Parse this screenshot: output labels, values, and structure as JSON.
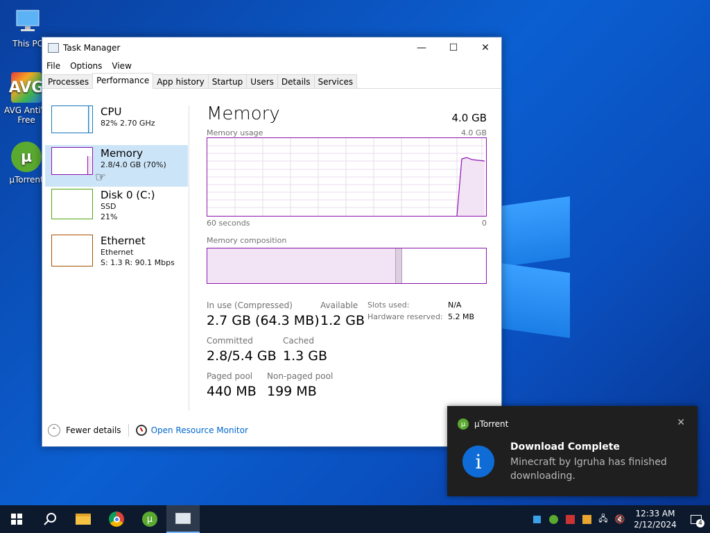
{
  "desktop": {
    "icons": [
      {
        "label": "This PC"
      },
      {
        "label": "AVG AntiVi Free"
      },
      {
        "label": "µTorrent"
      }
    ]
  },
  "window": {
    "title": "Task Manager",
    "menu": [
      "File",
      "Options",
      "View"
    ],
    "tabs": [
      "Processes",
      "Performance",
      "App history",
      "Startup",
      "Users",
      "Details",
      "Services"
    ],
    "active_tab": "Performance"
  },
  "sidebar": {
    "items": [
      {
        "name": "CPU",
        "sub1": "82%  2.70 GHz",
        "sub2": "",
        "color": "#1779ba"
      },
      {
        "name": "Memory",
        "sub1": "2.8/4.0 GB (70%)",
        "sub2": "",
        "color": "#8b12ae"
      },
      {
        "name": "Disk 0 (C:)",
        "sub1": "SSD",
        "sub2": "21%",
        "color": "#4da60c"
      },
      {
        "name": "Ethernet",
        "sub1": "Ethernet",
        "sub2": "S: 1.3  R: 90.1 Mbps",
        "color": "#a74f01"
      }
    ]
  },
  "memory": {
    "title": "Memory",
    "total": "4.0 GB",
    "usage_label": "Memory usage",
    "usage_max": "4.0 GB",
    "axis_left": "60 seconds",
    "axis_right": "0",
    "composition_label": "Memory composition",
    "stats": {
      "in_use_label": "In use (Compressed)",
      "in_use_value": "2.7 GB (64.3 MB)",
      "available_label": "Available",
      "available_value": "1.2 GB",
      "committed_label": "Committed",
      "committed_value": "2.8/5.4 GB",
      "cached_label": "Cached",
      "cached_value": "1.3 GB",
      "paged_label": "Paged pool",
      "paged_value": "440 MB",
      "nonpaged_label": "Non-paged pool",
      "nonpaged_value": "199 MB",
      "slots_label": "Slots used:",
      "slots_value": "N/A",
      "hw_reserved_label": "Hardware reserved:",
      "hw_reserved_value": "5.2 MB"
    }
  },
  "footer": {
    "fewer_details": "Fewer details",
    "open_monitor": "Open Resource Monitor"
  },
  "toast": {
    "app": "µTorrent",
    "title": "Download Complete",
    "message": "Minecraft by Igruha has finished downloading."
  },
  "taskbar": {
    "time": "12:33 AM",
    "date": "2/12/2024",
    "notification_count": "4"
  },
  "colors": {
    "memory": "#8b12ae",
    "accent_link": "#0066cc"
  }
}
